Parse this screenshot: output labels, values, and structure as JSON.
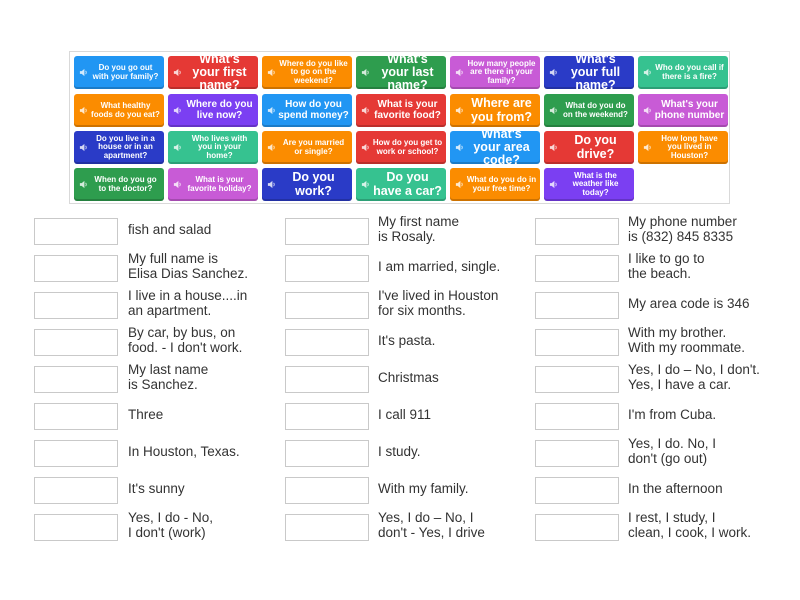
{
  "tiles": [
    {
      "text": "Do you go out with your family?",
      "color": "#2196f3",
      "size": "s"
    },
    {
      "text": "What's your first name?",
      "color": "#e53935",
      "size": "l"
    },
    {
      "text": "Where do you like to go on the weekend?",
      "color": "#fb8c00",
      "size": "s"
    },
    {
      "text": "What's your last name?",
      "color": "#2e9d4e",
      "size": "l"
    },
    {
      "text": "How many people are there in your family?",
      "color": "#c85bd6",
      "size": "s"
    },
    {
      "text": "What's your full name?",
      "color": "#2a3bc7",
      "size": "l"
    },
    {
      "text": "Who do you call if there is a fire?",
      "color": "#36c290",
      "size": "s"
    },
    {
      "text": "What healthy foods do you eat?",
      "color": "#fb8c00",
      "size": "s"
    },
    {
      "text": "Where do you live now?",
      "color": "#7b3ff2",
      "size": "m"
    },
    {
      "text": "How do you spend money?",
      "color": "#2196f3",
      "size": "m"
    },
    {
      "text": "What is your favorite food?",
      "color": "#e53935",
      "size": "m"
    },
    {
      "text": "Where are you from?",
      "color": "#fb8c00",
      "size": "l"
    },
    {
      "text": "What do you do on the weekend?",
      "color": "#2e9d4e",
      "size": "s"
    },
    {
      "text": "What's your phone number",
      "color": "#c85bd6",
      "size": "m"
    },
    {
      "text": "Do you live in a house or in an apartment?",
      "color": "#2a3bc7",
      "size": "s"
    },
    {
      "text": "Who lives with you in your home?",
      "color": "#36c290",
      "size": "s"
    },
    {
      "text": "Are you married or single?",
      "color": "#fb8c00",
      "size": "s"
    },
    {
      "text": "How do you get to work or school?",
      "color": "#e53935",
      "size": "s"
    },
    {
      "text": "What's your area code?",
      "color": "#2196f3",
      "size": "l"
    },
    {
      "text": "Do you drive?",
      "color": "#e53935",
      "size": "l"
    },
    {
      "text": "How long have you lived in Houston?",
      "color": "#fb8c00",
      "size": "s"
    },
    {
      "text": "When do you go to the doctor?",
      "color": "#2e9d4e",
      "size": "s"
    },
    {
      "text": "What is your favorite holiday?",
      "color": "#c85bd6",
      "size": "s"
    },
    {
      "text": "Do you work?",
      "color": "#2a3bc7",
      "size": "l"
    },
    {
      "text": "Do you have a car?",
      "color": "#36c290",
      "size": "l"
    },
    {
      "text": "What do you do in your free time?",
      "color": "#fb8c00",
      "size": "s"
    },
    {
      "text": "What is the weather like today?",
      "color": "#7b3ff2",
      "size": "s"
    }
  ],
  "answers": [
    [
      "fish and salad",
      "My first name\nis Rosaly.",
      "My phone number\nis (832) 845 8335"
    ],
    [
      "My full name is\nElisa Dias Sanchez.",
      "I am married, single.",
      "I like to go to\nthe beach."
    ],
    [
      "I live in a house....in\nan apartment.",
      "I've lived in Houston\nfor six months.",
      "My area code is 346"
    ],
    [
      "By car, by bus, on\nfood. - I don't work.",
      "It's pasta.",
      "With my brother.\nWith my roommate."
    ],
    [
      "My last name\nis Sanchez.",
      "Christmas",
      "Yes, I do – No, I don't.\nYes, I have a car."
    ],
    [
      "Three",
      "I call 911",
      "I'm from Cuba."
    ],
    [
      "In Houston, Texas.",
      "I study.",
      "Yes, I do. No, I\ndon't (go out)"
    ],
    [
      "It's sunny",
      "With my family.",
      "In the afternoon"
    ],
    [
      "Yes, I do - No,\nI don't (work)",
      "Yes, I do – No, I\ndon't - Yes, I drive",
      "I rest, I study, I\nclean, I cook, I work."
    ]
  ],
  "icons": {
    "tile_icon": "speaker-icon"
  }
}
